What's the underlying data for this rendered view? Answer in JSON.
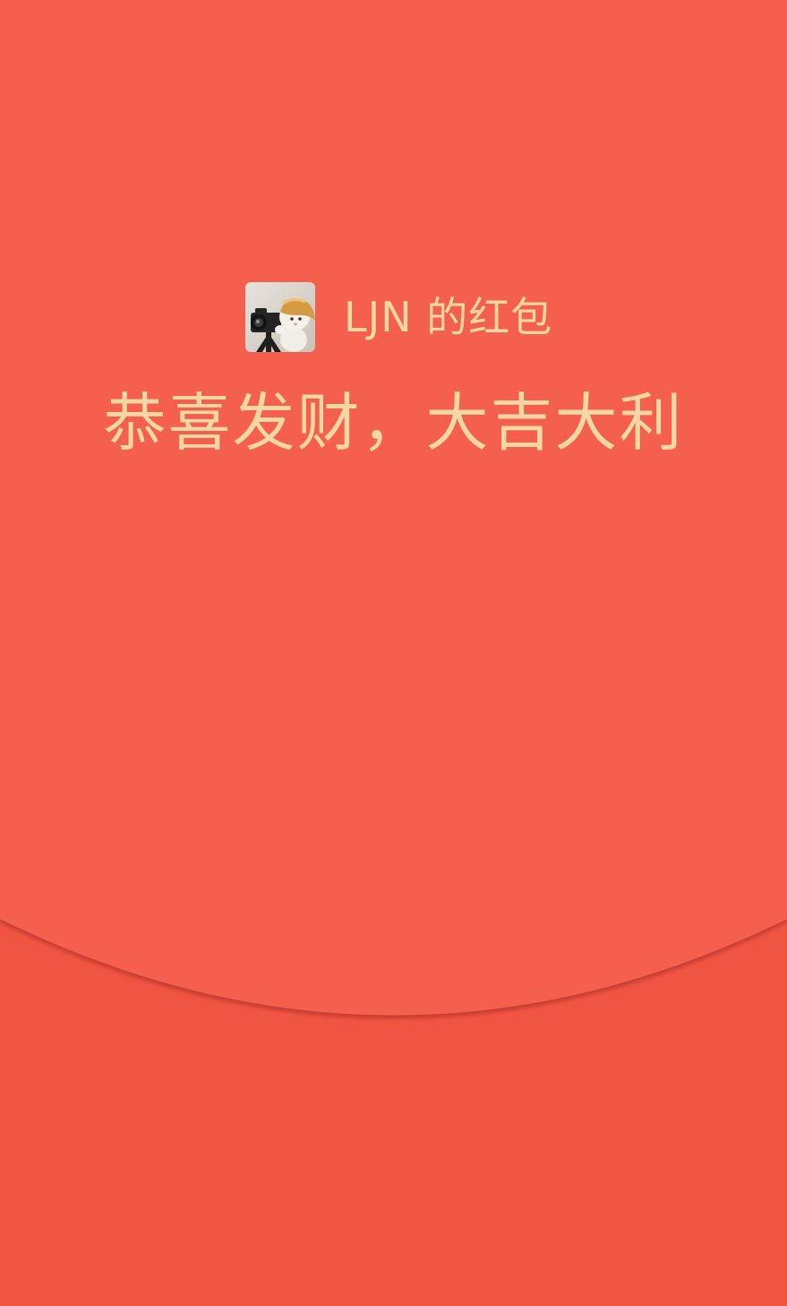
{
  "envelope": {
    "sender_label": "LJN 的红包",
    "greeting": "恭喜发财，大吉大利"
  },
  "avatar": {
    "icon": "cat-with-camera-avatar-icon"
  },
  "colors": {
    "envelope_top": "#f55f4e",
    "envelope_bottom": "#f05442",
    "text_gold": "#f4d7a2"
  }
}
